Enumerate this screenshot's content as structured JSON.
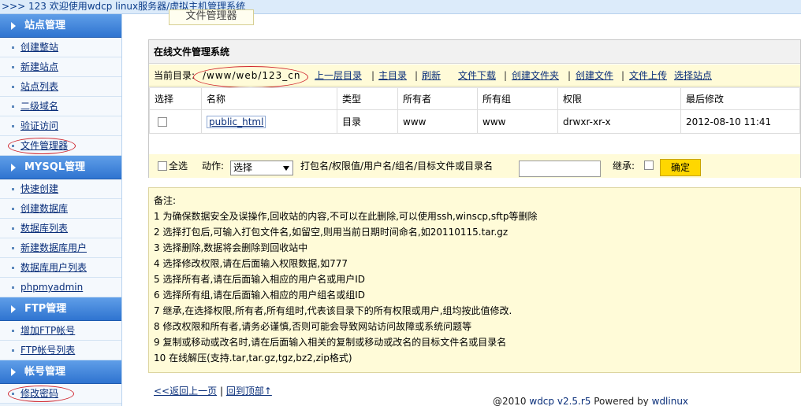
{
  "window": {
    "title": ">>> 123 欢迎使用wdcp linux服务器/虚拟主机管理系统"
  },
  "sidebar": {
    "groups": [
      {
        "title": "站点管理",
        "items": [
          "创建整站",
          "新建站点",
          "站点列表",
          "二级域名",
          "验证访问",
          "文件管理器"
        ]
      },
      {
        "title": "MYSQL管理",
        "items": [
          "快速创建",
          "创建数据库",
          "数据库列表",
          "新建数据库用户",
          "数据库用户列表",
          "phpmyadmin"
        ]
      },
      {
        "title": "FTP管理",
        "items": [
          "增加FTP帐号",
          "FTP帐号列表"
        ]
      },
      {
        "title": "帐号管理",
        "items": [
          "修改密码"
        ]
      }
    ]
  },
  "main": {
    "tab_label": "文件管理器",
    "panel_title": "在线文件管理系统",
    "pathbar": {
      "label": "当前目录:",
      "path": "/www/web/123_cn",
      "links": [
        "上一层目录",
        "主目录",
        "刷新",
        "文件下载",
        "创建文件夹",
        "创建文件",
        "文件上传",
        "选择站点"
      ]
    },
    "table": {
      "columns": [
        "选择",
        "名称",
        "类型",
        "所有者",
        "所有组",
        "权限",
        "最后修改"
      ],
      "rows": [
        {
          "name": "public_html",
          "type": "目录",
          "owner": "www",
          "group": "www",
          "perm": "drwxr-xr-x",
          "mtime": "2012-08-10 11:41"
        }
      ]
    },
    "actions": {
      "select_all": "全选",
      "action_label": "动作:",
      "action_value": "选择",
      "input_label": "打包名/权限值/用户名/组名/目标文件或目录名",
      "inherit_label": "继承:",
      "ok_label": "确定"
    },
    "notes": [
      "备注:",
      "1 为确保数据安全及误操作,回收站的内容,不可以在此删除,可以使用ssh,winscp,sftp等删除",
      "2 选择打包后,可输入打包文件名,如留空,则用当前日期时间命名,如20110115.tar.gz",
      "3 选择删除,数据将会删除到回收站中",
      "4 选择修改权限,请在后面输入权限数据,如777",
      "5 选择所有者,请在后面输入相应的用户名或用户ID",
      "6 选择所有组,请在后面输入相应的用户组名或组ID",
      "7 继承,在选择权限,所有者,所有组时,代表该目录下的所有权限或用户,组均按此值修改.",
      "8 修改权限和所有者,请务必谨慎,否则可能会导致网站访问故障或系统问题等",
      "9 复制或移动或改名时,请在后面输入相关的复制或移动或改名的目标文件名或目录名",
      "10 在线解压(支持.tar,tar.gz,tgz,bz2,zip格式)"
    ],
    "footer_back": "<<返回上一页",
    "footer_top": "回到顶部↑",
    "copyright_prefix": "@2010",
    "copyright_version": "wdcp  v2.5.r5",
    "copyright_powered": "Powered by",
    "copyright_brand": "wdlinux"
  },
  "colors": {
    "accent": "#2f74d0",
    "highlight": "#d0262e",
    "panel_bg": "#fffbd8"
  }
}
